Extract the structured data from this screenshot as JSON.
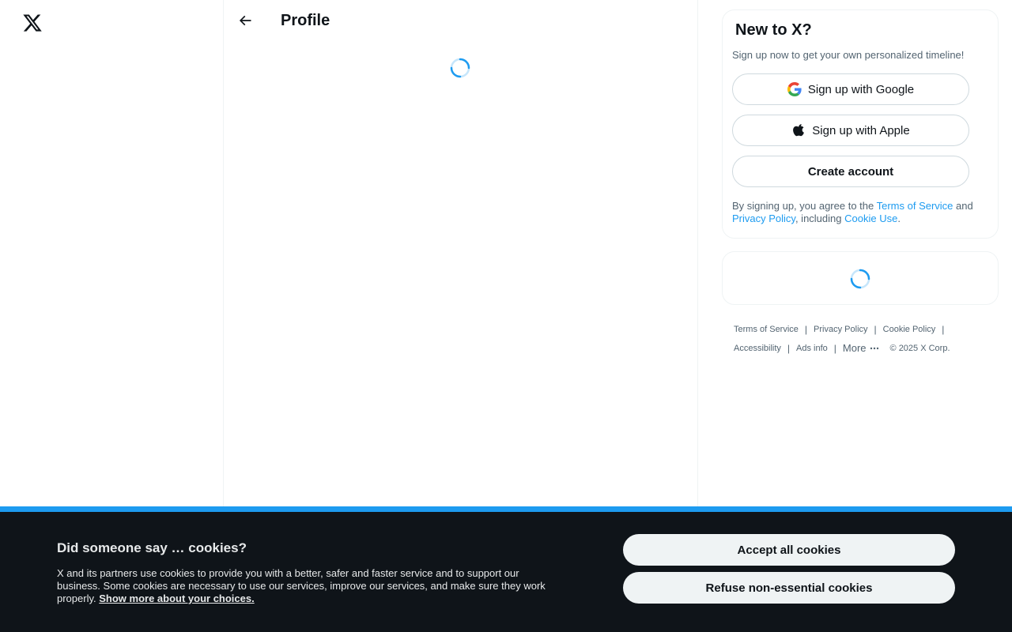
{
  "nav": {
    "logo_icon": "x-logo-icon"
  },
  "header": {
    "back_icon": "arrow-left-icon",
    "title": "Profile"
  },
  "signup": {
    "title": "New to X?",
    "subtitle": "Sign up now to get your own personalized timeline!",
    "google_label": "Sign up with Google",
    "apple_label": "Sign up with Apple",
    "create_label": "Create account",
    "legal_prefix": "By signing up, you agree to the ",
    "terms_link": "Terms of Service",
    "and_text": " and ",
    "privacy_link": "Privacy Policy",
    "including_text": ", including ",
    "cookie_link": "Cookie Use",
    "legal_suffix": "."
  },
  "footer": {
    "terms": "Terms of Service",
    "privacy": "Privacy Policy",
    "cookie": "Cookie Policy",
    "accessibility": "Accessibility",
    "ads": "Ads info",
    "more": "More",
    "more_icon": "ellipsis-icon",
    "copyright": "© 2025 X Corp.",
    "separator": "|"
  },
  "cookies": {
    "title": "Did someone say … cookies?",
    "body": "X and its partners use cookies to provide you with a better, safer and faster service and to support our business. Some cookies are necessary to use our services, improve our services, and make sure they work properly. ",
    "link": "Show more about your choices.",
    "accept": "Accept all cookies",
    "refuse": "Refuse non-essential cookies"
  },
  "colors": {
    "accent": "#1d9bf0",
    "text": "#0f1419",
    "muted": "#536471",
    "banner_bg": "#0f1419"
  }
}
